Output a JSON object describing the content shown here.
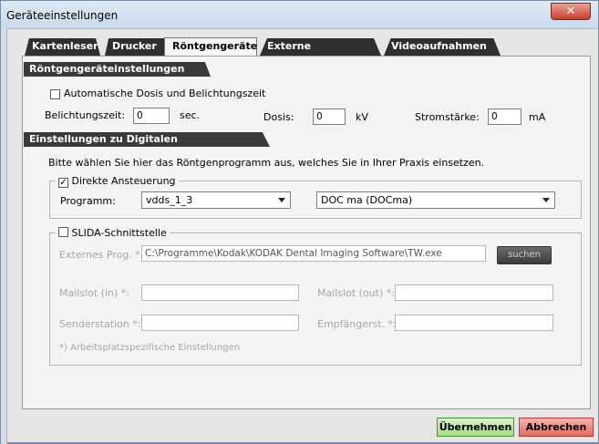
{
  "window": {
    "title": "Geräteeinstellungen",
    "close_glyph": "✕"
  },
  "tabs": [
    {
      "label": "Kartenleser",
      "active": false
    },
    {
      "label": "Drucker",
      "active": false
    },
    {
      "label": "Röntgengeräte",
      "active": true
    },
    {
      "label": "Externe Programme",
      "active": false
    },
    {
      "label": "Videoaufnahmen",
      "active": false
    }
  ],
  "roentgen": {
    "header": "Röntgengeräteinstellungen",
    "auto_label": "Automatische Dosis und Belichtungszeit",
    "auto_checked": false,
    "belichtung_label": "Belichtungszeit:",
    "belichtung_value": "0",
    "belichtung_unit": "sec.",
    "dosis_label": "Dosis:",
    "dosis_value": "0",
    "dosis_unit": "kV",
    "strom_label": "Stromstärke:",
    "strom_value": "0",
    "strom_unit": "mA"
  },
  "digital": {
    "header": "Einstellungen zu Digitalen Röntgensystemen",
    "info": "Bitte wählen Sie hier das Röntgenprogramm aus, welches Sie in Ihrer Praxis einsetzen.",
    "direkt_label": "Direkte Ansteuerung",
    "direkt_checked": true,
    "direkt_check_glyph": "✓",
    "programm_label": "Programm:",
    "programm_value": "vdds_1_3",
    "doc_value": "DOC ma (DOCma)",
    "slida_label": "SLIDA-Schnittstelle",
    "slida_checked": false,
    "extprog_label": "Externes Prog. *:",
    "extprog_value": "C:\\Programme\\Kodak\\KODAK Dental Imaging Software\\TW.exe",
    "suchen_label": "suchen",
    "mailslot_in_label": "Mailslot (in) *:",
    "mailslot_out_label": "Mailslot (out) *:",
    "sender_label": "Senderstation *:",
    "empf_label": "Empfängerst. *:",
    "footnote": "*) Arbeitsplatzspezifische Einstellungen"
  },
  "footer": {
    "ok_label": "Übernehmen",
    "cancel_label": "Abbrechen"
  },
  "colors": {
    "section_bg": "#3a3a3a",
    "ok_green": "#a5dc86",
    "cancel_red": "#e66a61",
    "close_red": "#c8412b"
  }
}
